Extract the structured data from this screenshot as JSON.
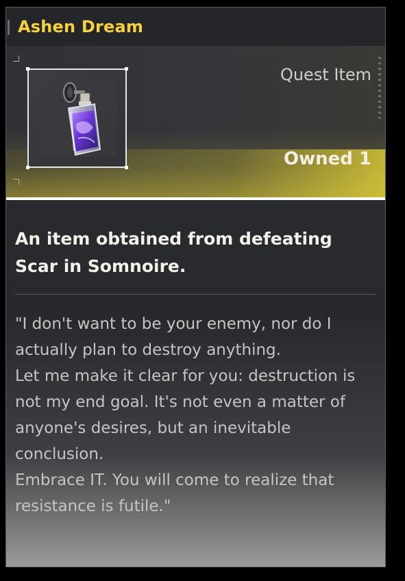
{
  "item": {
    "name": "Ashen Dream",
    "type": "Quest Item",
    "owned": "Owned 1",
    "icon": "purple-perfume-bottle-icon"
  },
  "description": "An item obtained from defeating Scar in Somnoire.",
  "quote": {
    "lines": [
      "\"I don't want to be your enemy, nor do I actually plan to destroy anything.",
      "Let me make it clear for you: destruction is not my end goal. It's not even a matter of anyone's desires, but an inevitable conclusion.",
      "Embrace IT. You will come to realize that resistance is futile.\""
    ]
  },
  "colors": {
    "title": "#f5d23b",
    "header_accent": "#d7c837",
    "text_primary": "#f4f1ea",
    "text_secondary": "#c5c5c5"
  }
}
